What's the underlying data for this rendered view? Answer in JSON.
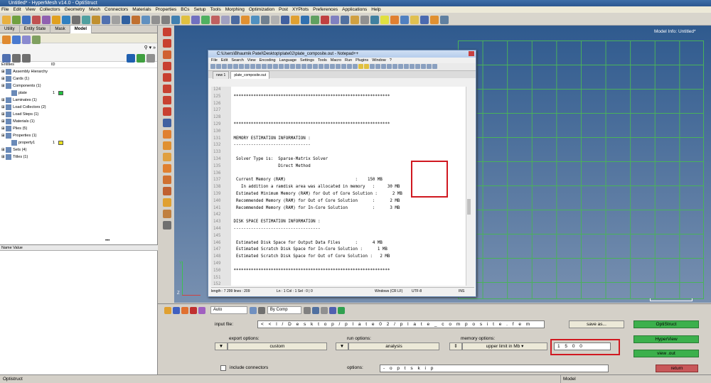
{
  "window": {
    "title": "Untitled* - HyperMesh v14.0 - OptiStruct"
  },
  "menu": [
    "File",
    "Edit",
    "View",
    "Collectors",
    "Geometry",
    "Mesh",
    "Connectors",
    "Materials",
    "Properties",
    "BCs",
    "Setup",
    "Tools",
    "Morphing",
    "Optimization",
    "Post",
    "XYPlots",
    "Preferences",
    "Applications",
    "Help"
  ],
  "left_panel": {
    "tabs": [
      "Utility",
      "Entity State",
      "Mask",
      "Model"
    ],
    "entities_header": "Entities",
    "id_header": "ID",
    "tree": [
      {
        "label": "Assembly Hierarchy",
        "indent": 0
      },
      {
        "label": "Cards (1)",
        "indent": 0
      },
      {
        "label": "Components (1)",
        "indent": 0
      },
      {
        "label": "plate",
        "indent": 1,
        "id": "1",
        "color": "#22c040"
      },
      {
        "label": "Laminates (1)",
        "indent": 0
      },
      {
        "label": "Load Collectors (2)",
        "indent": 0
      },
      {
        "label": "Load Steps (1)",
        "indent": 0
      },
      {
        "label": "Materials (1)",
        "indent": 0
      },
      {
        "label": "Plies (5)",
        "indent": 0
      },
      {
        "label": "Properties (1)",
        "indent": 0
      },
      {
        "label": "property1",
        "indent": 1,
        "id": "1",
        "color": "#e8e020"
      },
      {
        "label": "Sets (4)",
        "indent": 0
      },
      {
        "label": "Titles (1)",
        "indent": 0
      }
    ],
    "name_value_header": "Name Value"
  },
  "viewport": {
    "model_info": "Model Info: Untitled*",
    "scale_label": "10"
  },
  "notepad": {
    "title": "C:\\Users\\Bhaumik Patel\\Desktop\\plate02\\plate_composite.out - Notepad++",
    "menu": [
      "File",
      "Edit",
      "Search",
      "View",
      "Encoding",
      "Language",
      "Settings",
      "Tools",
      "Macro",
      "Run",
      "Plugins",
      "Window",
      "?"
    ],
    "tabs": [
      "new 1",
      "plate_composite.out"
    ],
    "lines": [
      {
        "n": "124",
        "t": ""
      },
      {
        "n": "125",
        "t": " ***************************************************************"
      },
      {
        "n": "126",
        "t": ""
      },
      {
        "n": "127",
        "t": ""
      },
      {
        "n": "128",
        "t": ""
      },
      {
        "n": "129",
        "t": " ***************************************************************"
      },
      {
        "n": "130",
        "t": ""
      },
      {
        "n": "131",
        "t": " MEMORY ESTIMATION INFORMATION :"
      },
      {
        "n": "132",
        "t": " -------------------------------"
      },
      {
        "n": "133",
        "t": ""
      },
      {
        "n": "134",
        "t": "  Solver Type is:  Sparse-Matrix Solver"
      },
      {
        "n": "135",
        "t": "                   Direct Method"
      },
      {
        "n": "136",
        "t": ""
      },
      {
        "n": "137",
        "t": "  Current Memory (RAM)                            :    150 MB"
      },
      {
        "n": "138",
        "t": "    In addition a ramdisk area was allocated in memory   :     30 MB"
      },
      {
        "n": "139",
        "t": "  Estimated Minimum Memory (RAM) for Out of Core Solution :      2 MB"
      },
      {
        "n": "140",
        "t": "  Recommended Memory (RAM) for Out of Core Solution      :      2 MB"
      },
      {
        "n": "141",
        "t": "  Recommended Memory (RAM) for In-Core Solution          :      3 MB"
      },
      {
        "n": "142",
        "t": ""
      },
      {
        "n": "143",
        "t": " DISK SPACE ESTIMATION INFORMATION :"
      },
      {
        "n": "144",
        "t": " -----------------------------------"
      },
      {
        "n": "145",
        "t": ""
      },
      {
        "n": "146",
        "t": "  Estimated Disk Space for Output Data Files      :      4 MB"
      },
      {
        "n": "147",
        "t": "  Estimated Scratch Disk Space for In-Core Solution :      1 MB"
      },
      {
        "n": "148",
        "t": "  Estimated Scratch Disk Space for Out of Core Solution :   2 MB"
      },
      {
        "n": "149",
        "t": ""
      },
      {
        "n": "150",
        "t": " ***************************************************************"
      },
      {
        "n": "151",
        "t": ""
      },
      {
        "n": "152",
        "t": ""
      },
      {
        "n": "153",
        "t": " BEGINNING ANALYSIS SOLUTION ...."
      },
      {
        "n": "154",
        "t": ""
      },
      {
        "n": "155",
        "t": ""
      },
      {
        "n": "156",
        "t": ""
      }
    ],
    "status": {
      "length": "length : 7 299   lines : 209",
      "pos": "Ln : 1   Col : 1   Sel : 0 | 0",
      "eol": "Windows (CR LF)",
      "enc": "UTF-8",
      "ins": "INS"
    }
  },
  "bottom_toolbar": {
    "auto_label": "Auto",
    "by_comp_label": "By Comp"
  },
  "optistruct_panel": {
    "input_file_label": "input file:",
    "input_file_value": "< < l / D e s k t o p / p l a t e 0 2 / p l a t e _ c o m p o s i t e . f e m",
    "save_as_label": "save as...",
    "export_options_label": "export options:",
    "export_value": "custom",
    "run_options_label": "run options:",
    "run_value": "analysis",
    "memory_options_label": "memory options:",
    "memory_value": "upper limit in Mb",
    "memory_limit": "1 5 0 0",
    "include_connectors_label": "include connectors",
    "options_label": "options:",
    "options_value": "- o p t s k i p",
    "optistruct_button": "OptiStruct",
    "hyperview_button": "HyperView",
    "view_out_button": "view .out",
    "return_button": "return"
  },
  "statusbar": {
    "left": "Optistruct",
    "right": "Model"
  }
}
